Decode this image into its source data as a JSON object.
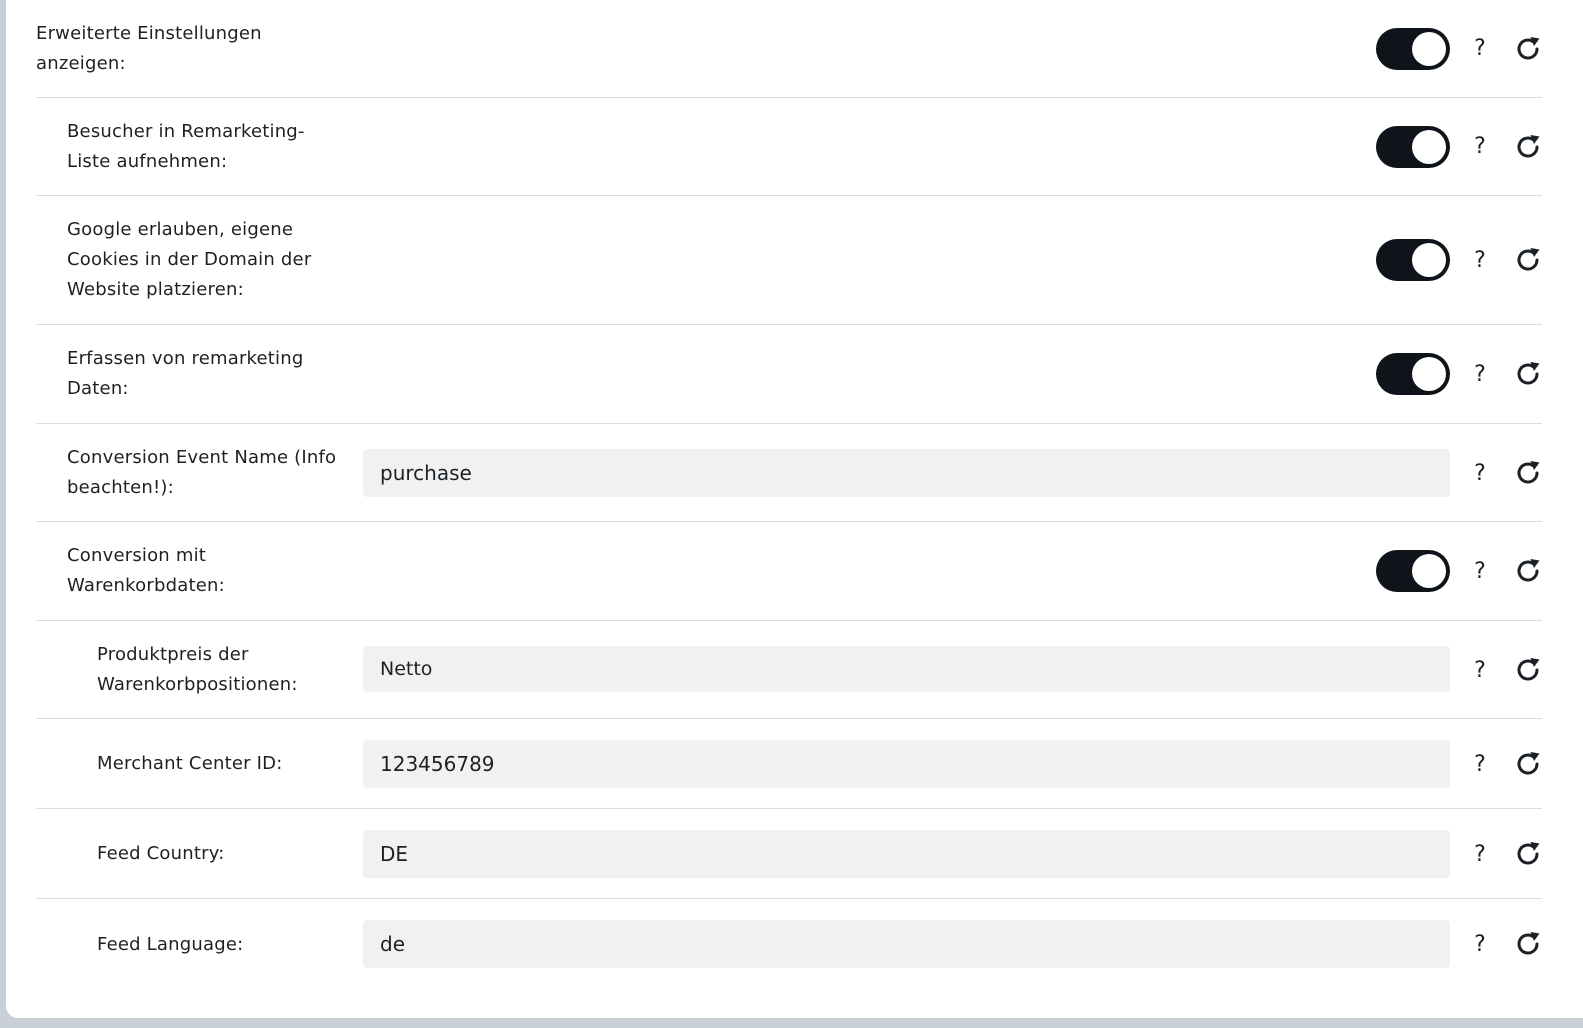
{
  "settings": [
    {
      "label": "Erweiterte Einstellungen\nanzeigen:",
      "type": "toggle",
      "on": true
    },
    {
      "label": "Besucher in Remarketing-\nListe aufnehmen:",
      "type": "toggle",
      "on": true
    },
    {
      "label": "Google erlauben, eigene\nCookies in der Domain der\nWebsite platzieren:",
      "type": "toggle",
      "on": true
    },
    {
      "label": "Erfassen von remarketing\nDaten:",
      "type": "toggle",
      "on": true
    },
    {
      "label": "Conversion Event Name (Info\nbeachten!):",
      "type": "input",
      "value": "purchase"
    },
    {
      "label": "Conversion mit\nWarenkorbdaten:",
      "type": "toggle",
      "on": true
    },
    {
      "label": "Produktpreis der\nWarenkorbpositionen:",
      "type": "select",
      "value": "Netto"
    },
    {
      "label": "Merchant Center ID:",
      "type": "input",
      "value": "123456789"
    },
    {
      "label": "Feed Country:",
      "type": "input",
      "value": "DE"
    },
    {
      "label": "Feed Language:",
      "type": "input",
      "value": "de"
    }
  ],
  "help_symbol": "?",
  "icons": {
    "help": "question-mark-icon",
    "reset": "reset-arrow-icon"
  },
  "colors": {
    "toggle_on": "#0e1419",
    "field_bg": "#f1f1f1",
    "divider": "#dcdcdc"
  }
}
